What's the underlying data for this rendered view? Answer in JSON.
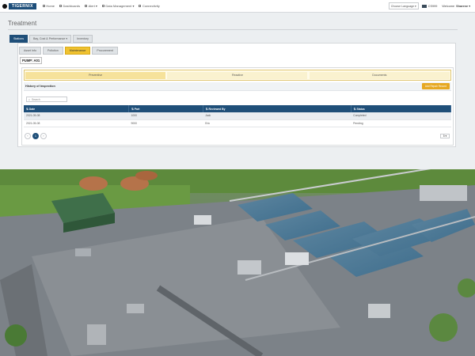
{
  "brand": {
    "name": "TIGERNIX"
  },
  "nav": [
    {
      "label": "Home"
    },
    {
      "label": "Dashboards"
    },
    {
      "label": "Alert ▾"
    },
    {
      "label": "Data Management ▾"
    },
    {
      "label": "Connectivity"
    }
  ],
  "header": {
    "language_placeholder": "Choose Language",
    "user_group": "CS999",
    "welcome_label": "Welcome",
    "user_name": "Sharene"
  },
  "page": {
    "title": "Treatment"
  },
  "tabs_primary": [
    {
      "label": "Stations",
      "active": true
    },
    {
      "label": "Bay, Cost & Performance ▾",
      "active": false
    },
    {
      "label": "Inventory",
      "active": false
    }
  ],
  "tabs_secondary": [
    {
      "label": "Asset Info",
      "active": false
    },
    {
      "label": "Pollution",
      "active": false
    },
    {
      "label": "Maintenance",
      "active": true
    },
    {
      "label": "Procurement",
      "active": false
    }
  ],
  "pump": {
    "label": "PUMP: A01"
  },
  "subtabs": [
    {
      "label": "Preventive",
      "active": true
    },
    {
      "label": "Reactive",
      "active": false
    },
    {
      "label": "Documents",
      "active": false
    }
  ],
  "history": {
    "title": "History of Inspection",
    "add_button": "Add Repair Record"
  },
  "search": {
    "placeholder": "Search"
  },
  "table": {
    "columns": [
      "Date",
      "Part",
      "Reviewed By",
      "Status"
    ],
    "rows": [
      [
        "2021-05-08",
        "1000",
        "Jack",
        "Completed"
      ],
      [
        "2021-05-08",
        "9000",
        "Eric",
        "Pending"
      ]
    ]
  },
  "pagination": {
    "prev": "‹",
    "current": "1",
    "next": "›",
    "page_size": "5 ▾"
  },
  "colors": {
    "primary": "#1f4f79",
    "accent": "#f0c230",
    "button": "#e6a822"
  }
}
